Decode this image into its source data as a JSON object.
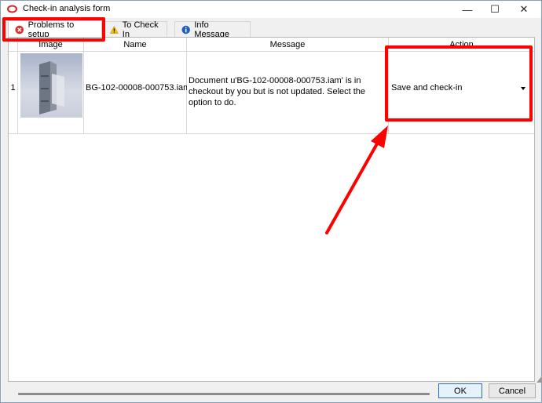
{
  "window": {
    "title": "Check-in analysis form",
    "controls": {
      "minimize": "—",
      "maximize": "☐",
      "close": "✕"
    }
  },
  "tabs": [
    {
      "label": "Problems to setup",
      "icon": "error-icon",
      "active": true
    },
    {
      "label": "To Check In",
      "icon": "warning-icon",
      "active": false
    },
    {
      "label": "Info Message",
      "icon": "info-icon",
      "active": false
    }
  ],
  "table": {
    "columns": [
      "Image",
      "Name",
      "Message",
      "Action"
    ],
    "rows": [
      {
        "index": "1",
        "name": "BG-102-00008-000753.iam",
        "message": "Document u'BG-102-00008-000753.iam' is in checkout by you but is not updated. Select the option to do.",
        "action": "Save and check-in"
      }
    ]
  },
  "buttons": {
    "ok": "OK",
    "cancel": "Cancel"
  },
  "colors": {
    "highlight": "#ff0000",
    "accent": "#2b6cc4"
  }
}
